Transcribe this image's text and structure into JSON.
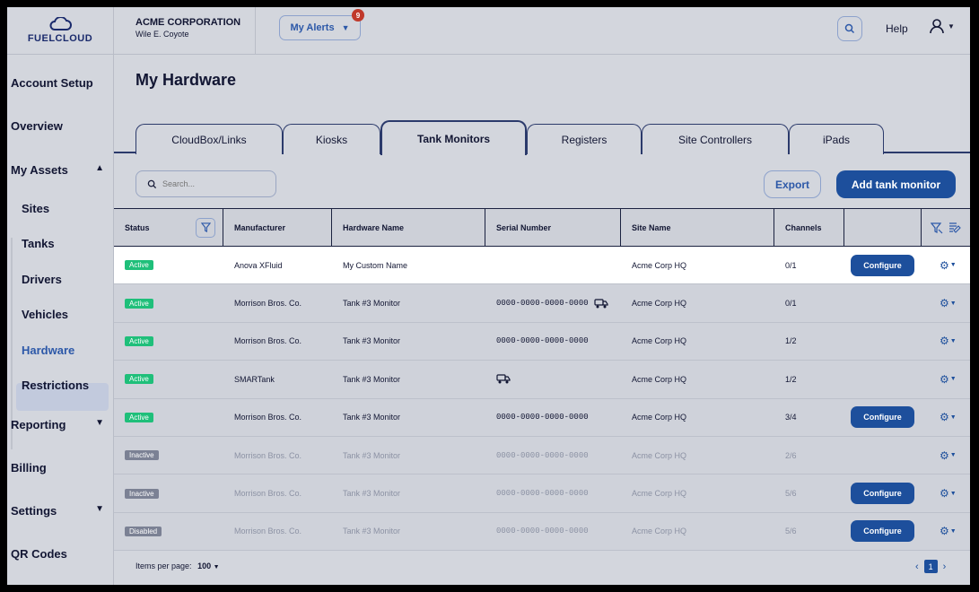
{
  "brand": {
    "logo_text": "FUELCLOUD"
  },
  "header": {
    "company_name": "ACME CORPORATION",
    "user_name": "Wile E. Coyote",
    "alerts_label": "My Alerts",
    "alerts_count": "9",
    "help_label": "Help"
  },
  "sidebar": {
    "items": [
      {
        "label": "Account Setup"
      },
      {
        "label": "Overview"
      },
      {
        "label": "My Assets"
      },
      {
        "label": "Reporting"
      },
      {
        "label": "Billing"
      },
      {
        "label": "Settings"
      },
      {
        "label": "QR Codes"
      }
    ],
    "sub_items": [
      {
        "label": "Sites"
      },
      {
        "label": "Tanks"
      },
      {
        "label": "Drivers"
      },
      {
        "label": "Vehicles"
      },
      {
        "label": "Hardware"
      },
      {
        "label": "Restrictions"
      }
    ]
  },
  "page": {
    "title": "My Hardware"
  },
  "tabs": [
    {
      "label": "CloudBox/Links"
    },
    {
      "label": "Kiosks"
    },
    {
      "label": "Tank Monitors"
    },
    {
      "label": "Registers"
    },
    {
      "label": "Site Controllers"
    },
    {
      "label": "iPads"
    }
  ],
  "toolbar": {
    "search_placeholder": "Search...",
    "export_label": "Export",
    "add_label": "Add tank monitor"
  },
  "table": {
    "columns": [
      "Status",
      "Manufacturer",
      "Hardware Name",
      "Serial Number",
      "Site Name",
      "Channels"
    ],
    "rows": [
      {
        "status": "Active",
        "manufacturer": "Anova XFluid",
        "name": "My Custom Name",
        "serial": "",
        "site": "Acme Corp HQ",
        "channels": "0/1",
        "configure": "Configure"
      },
      {
        "status": "Active",
        "manufacturer": "Morrison Bros. Co.",
        "name": "Tank #3 Monitor",
        "serial": "0000-0000-0000-0000",
        "site": "Acme Corp HQ",
        "channels": "0/1",
        "configure": ""
      },
      {
        "status": "Active",
        "manufacturer": "Morrison Bros. Co.",
        "name": "Tank #3 Monitor",
        "serial": "0000-0000-0000-0000",
        "site": "Acme Corp HQ",
        "channels": "1/2",
        "configure": ""
      },
      {
        "status": "Active",
        "manufacturer": "SMARTank",
        "name": "Tank #3 Monitor",
        "serial": "",
        "site": "Acme Corp HQ",
        "channels": "1/2",
        "configure": ""
      },
      {
        "status": "Active",
        "manufacturer": "Morrison Bros. Co.",
        "name": "Tank #3 Monitor",
        "serial": "0000-0000-0000-0000",
        "site": "Acme Corp HQ",
        "channels": "3/4",
        "configure": "Configure"
      },
      {
        "status": "Inactive",
        "manufacturer": "Morrison Bros. Co.",
        "name": "Tank #3 Monitor",
        "serial": "0000-0000-0000-0000",
        "site": "Acme Corp HQ",
        "channels": "2/6",
        "configure": ""
      },
      {
        "status": "Inactive",
        "manufacturer": "Morrison Bros. Co.",
        "name": "Tank #3 Monitor",
        "serial": "0000-0000-0000-0000",
        "site": "Acme Corp HQ",
        "channels": "5/6",
        "configure": "Configure"
      },
      {
        "status": "Disabled",
        "manufacturer": "Morrison Bros. Co.",
        "name": "Tank #3 Monitor",
        "serial": "0000-0000-0000-0000",
        "site": "Acme Corp HQ",
        "channels": "5/6",
        "configure": "Configure"
      }
    ]
  },
  "footer": {
    "items_per_page_label": "Items per page:",
    "items_per_page_value": "100",
    "current_page": "1"
  },
  "colors": {
    "accent": "#1d4f9c",
    "active": "#1fbf7a",
    "inactive": "#7b8194",
    "badge": "#c0392b"
  }
}
